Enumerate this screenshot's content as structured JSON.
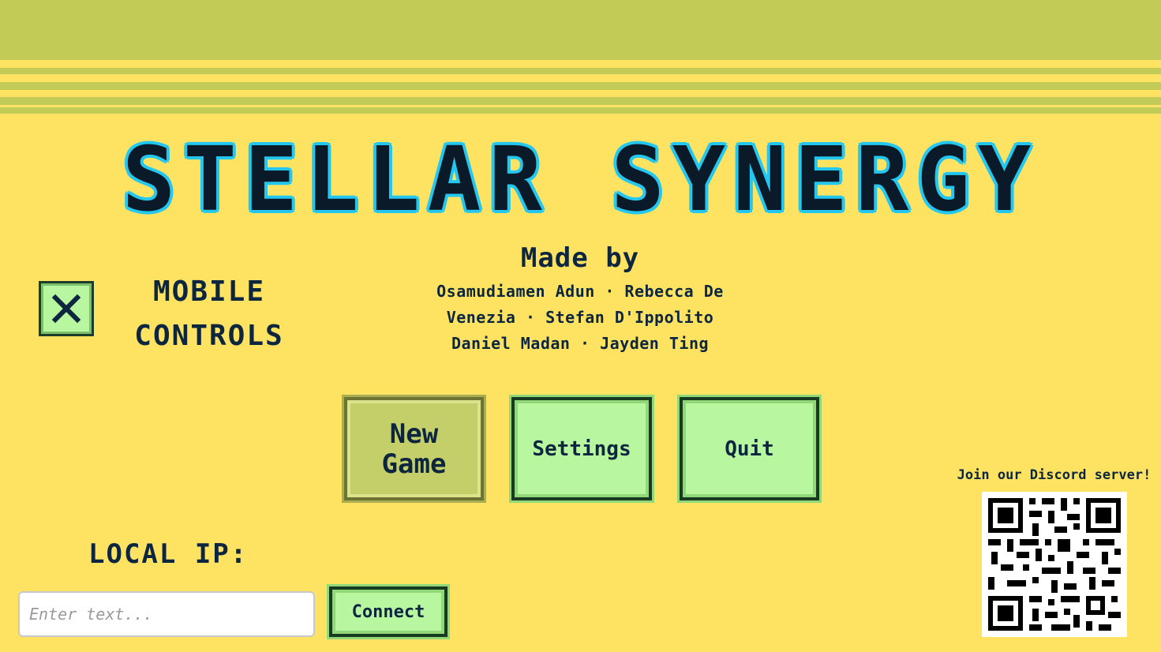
{
  "game": {
    "title": "STELLAR SYNERGY"
  },
  "credits": {
    "heading": "Made by",
    "lines": [
      "Osamudiamen Adun · Rebecca De",
      "Venezia · Stefan D'Ippolito",
      "Daniel Madan · Jayden Ting"
    ]
  },
  "mobile_controls": {
    "checked": true,
    "label_line1": "MOBILE",
    "label_line2": "CONTROLS"
  },
  "menu": {
    "new_game_line1": "New",
    "new_game_line2": "Game",
    "settings": "Settings",
    "quit": "Quit"
  },
  "connect": {
    "label": "LOCAL IP:",
    "placeholder": "Enter text...",
    "value": "",
    "button": "Connect"
  },
  "discord": {
    "label": "Join our Discord server!",
    "qr_icon": "qr-code-icon"
  },
  "colors": {
    "background": "#fee362",
    "top_band": "#c1cb55",
    "button": "#b8f7a0",
    "title_outline": "#23c7f0"
  }
}
